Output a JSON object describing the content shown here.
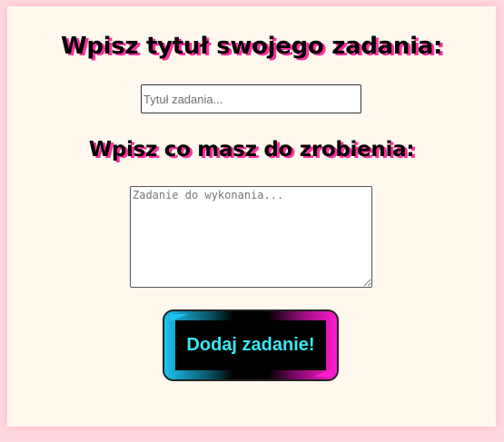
{
  "form": {
    "title_heading": "Wpisz tytuł swojego zadania:",
    "title_placeholder": "Tytuł zadania...",
    "title_value": "",
    "task_heading": "Wpisz co masz do zrobienia:",
    "task_placeholder": "Zadanie do wykonania...",
    "task_value": "",
    "submit_label": "Dodaj zadanie!"
  },
  "colors": {
    "page_background": "#ffd9e0",
    "panel_background": "#fff8ee",
    "heading_shadow": "#ff2fa0",
    "button_text": "#37e8f2",
    "button_accent_left": "#1cc3f2",
    "button_accent_right": "#ff1ccf"
  }
}
